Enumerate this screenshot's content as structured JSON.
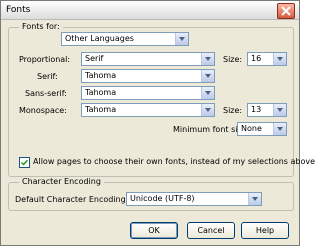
{
  "window": {
    "title": "Fonts"
  },
  "fonts_group": {
    "legend": "Fonts for:",
    "fonts_for_value": "Other Languages",
    "proportional": {
      "label": "Proportional:",
      "value": "Serif"
    },
    "size1": {
      "label": "Size:",
      "value": "16"
    },
    "serif": {
      "label": "Serif:",
      "value": "Tahoma"
    },
    "sans_serif": {
      "label": "Sans-serif:",
      "value": "Tahoma"
    },
    "monospace": {
      "label": "Monospace:",
      "value": "Tahoma"
    },
    "size2": {
      "label": "Size:",
      "value": "13"
    },
    "min_size": {
      "label": "Minimum font size:",
      "value": "None"
    },
    "allow_pages_label": "Allow pages to choose their own fonts, instead of my selections above"
  },
  "encoding_group": {
    "legend": "Character Encoding",
    "label": "Default Character Encoding:",
    "value": "Unicode (UTF-8)"
  },
  "buttons": {
    "ok": "OK",
    "cancel": "Cancel",
    "help": "Help"
  }
}
